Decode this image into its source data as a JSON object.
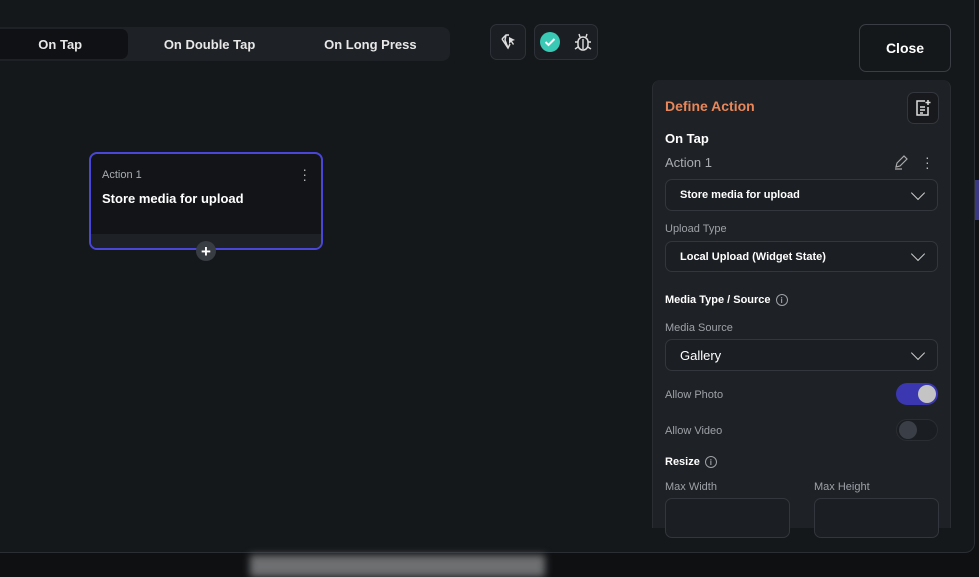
{
  "tabs": [
    {
      "label": "On Tap",
      "active": true
    },
    {
      "label": "On Double Tap"
    },
    {
      "label": "On Long Press"
    }
  ],
  "header": {
    "close_label": "Close",
    "debug_status": "ok",
    "colors": {
      "check": "#39c9b4",
      "accent": "#4a46d8",
      "title": "#e8875a"
    }
  },
  "canvas": {
    "action_card": {
      "label": "Action 1",
      "title": "Store media for upload"
    }
  },
  "panel": {
    "title": "Define Action",
    "trigger": "On Tap",
    "action_name": "Action 1",
    "action_type": "Store media for upload",
    "upload_type_label": "Upload Type",
    "upload_type": "Local Upload (Widget State)",
    "media_section": "Media Type / Source",
    "media_source_label": "Media Source",
    "media_source": "Gallery",
    "allow_photo_label": "Allow Photo",
    "allow_photo": true,
    "allow_video_label": "Allow Video",
    "allow_video": false,
    "resize_label": "Resize",
    "max_width_label": "Max Width",
    "max_height_label": "Max Height",
    "max_width": "",
    "max_height": ""
  }
}
